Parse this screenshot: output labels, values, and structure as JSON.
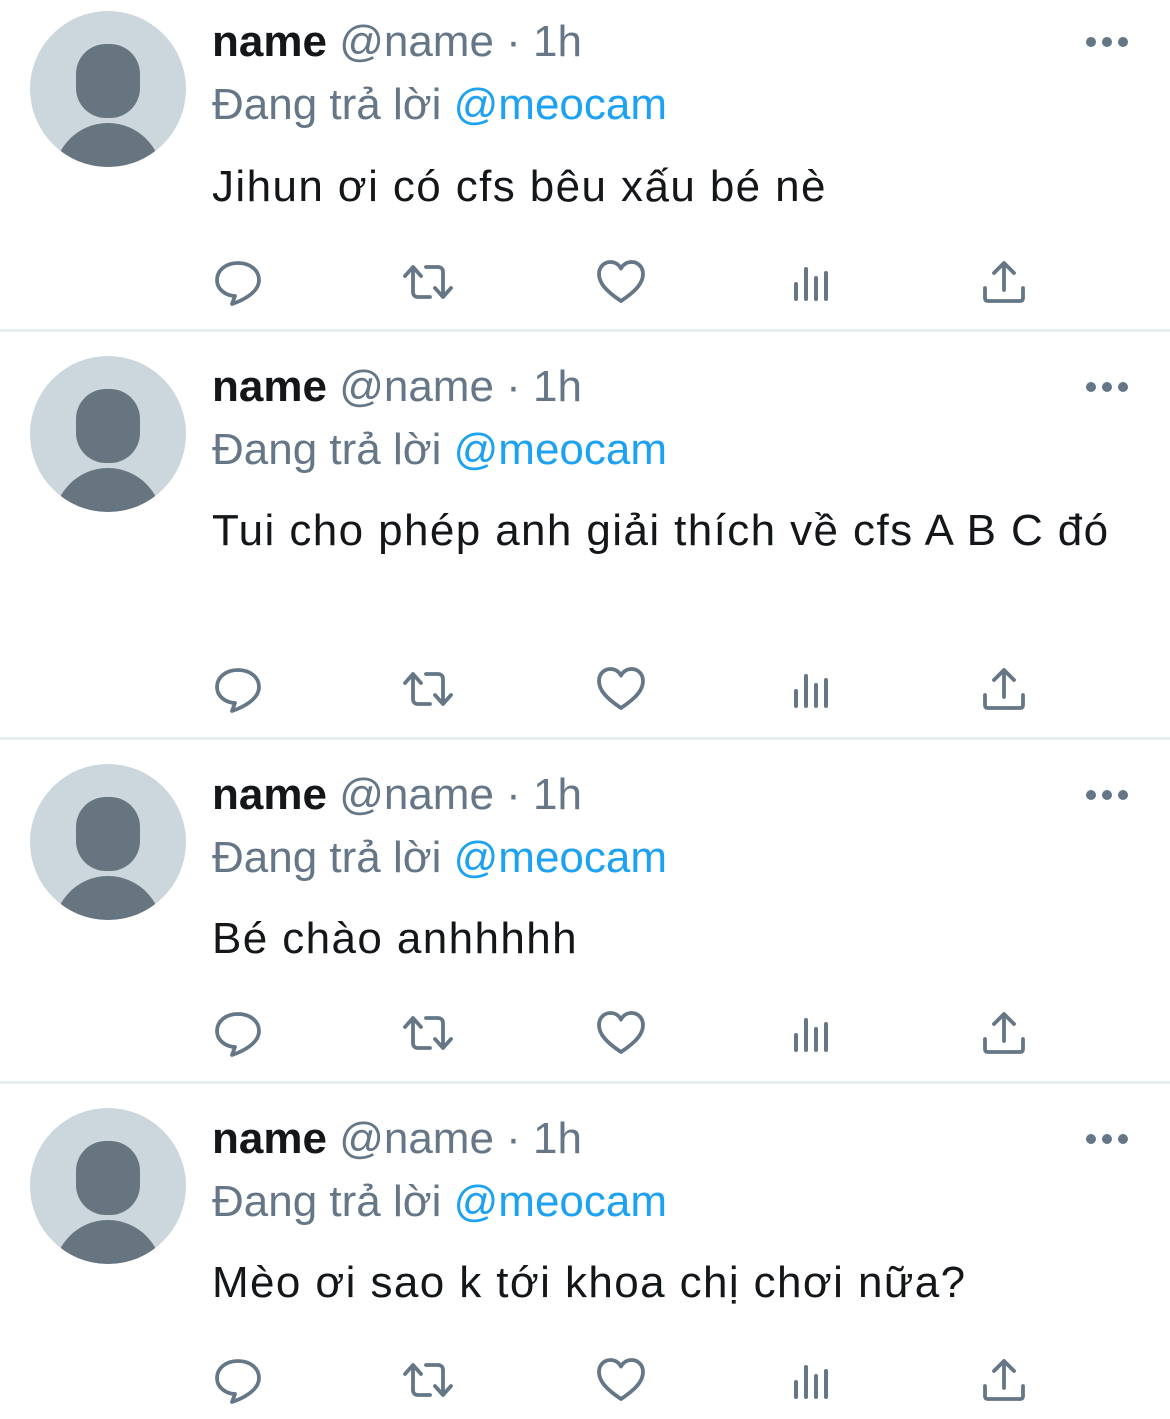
{
  "feed": {
    "tweets": [
      {
        "display_name": "name",
        "handle": "@name",
        "separator": "·",
        "time": "1h",
        "reply_prefix": "Đang trả lời",
        "reply_to": "@meocam",
        "text": "Jihun ơi có cfs bêu xấu bé nè"
      },
      {
        "display_name": "name",
        "handle": "@name",
        "separator": "·",
        "time": "1h",
        "reply_prefix": "Đang trả lời",
        "reply_to": "@meocam",
        "text": "Tui cho phép anh giải thích về cfs A B C đó"
      },
      {
        "display_name": "name",
        "handle": "@name",
        "separator": "·",
        "time": "1h",
        "reply_prefix": "Đang trả lời",
        "reply_to": "@meocam",
        "text": "Bé chào anhhhhh"
      },
      {
        "display_name": "name",
        "handle": "@name",
        "separator": "·",
        "time": "1h",
        "reply_prefix": "Đang trả lời",
        "reply_to": "@meocam",
        "text": "Mèo ơi sao k tới khoa chị chơi nữa?"
      }
    ]
  },
  "icons": {
    "more": "more-horizontal-icon",
    "reply": "reply-bubble-icon",
    "retweet": "retweet-icon",
    "like": "heart-icon",
    "analytics": "analytics-bars-icon",
    "share": "share-upload-icon"
  },
  "colors": {
    "text_primary": "#14171a",
    "text_secondary": "#657786",
    "link": "#1da1f2",
    "avatar_bg": "#ccd6dd",
    "avatar_fg": "#66757f",
    "divider": "#e6ecf0"
  }
}
